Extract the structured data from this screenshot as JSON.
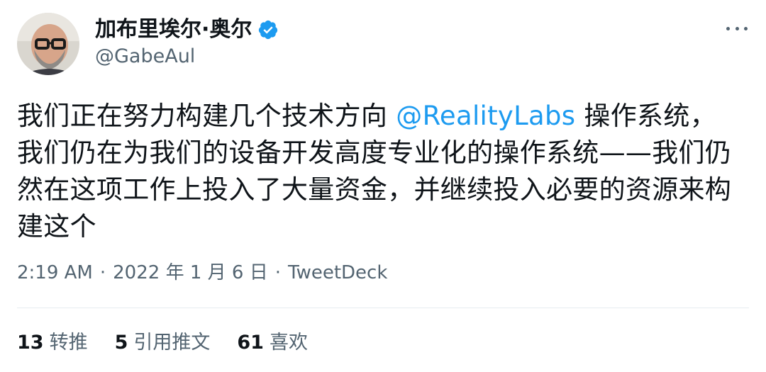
{
  "author": {
    "display_name": "加布里埃尔·奥尔",
    "handle": "@GabeAul",
    "verified_icon": "verified-badge-icon"
  },
  "menu": {
    "icon": "more-horizontal-icon"
  },
  "tweet": {
    "text_before_mention": "我们正在努力构建几个技术方向 ",
    "mention": "@RealityLabs",
    "text_after_mention": " 操作系统，我们仍在为我们的设备开发高度专业化的操作系统——我们仍然在这项工作上投入了大量资金，并继续投入必要的资源来构建这个"
  },
  "meta": {
    "time": "2:19 AM",
    "separator_1": "·",
    "date": "2022 年 1 月 6 日",
    "separator_2": "·",
    "source": "TweetDeck"
  },
  "stats": {
    "retweets": {
      "count": "13",
      "label": "转推"
    },
    "quotes": {
      "count": "5",
      "label": "引用推文"
    },
    "likes": {
      "count": "61",
      "label": "喜欢"
    }
  },
  "colors": {
    "link": "#1d9bf0",
    "secondary_text": "#536471",
    "primary_text": "#0f1419",
    "divider": "#e6ecf0"
  }
}
